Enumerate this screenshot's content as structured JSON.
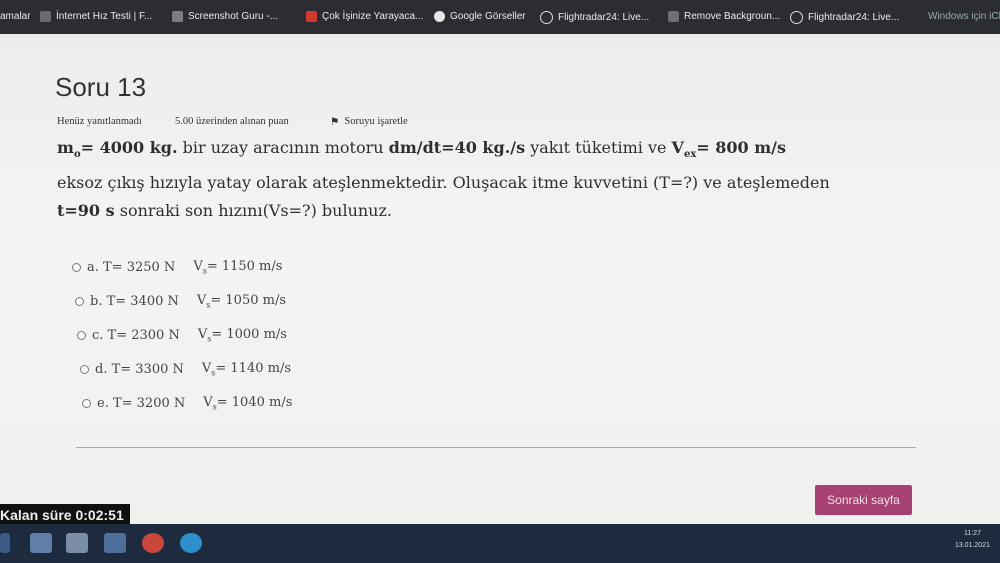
{
  "bookmarks": [
    {
      "label": "amalar",
      "color": "#2b2d33"
    },
    {
      "label": "İnternet Hız Testi | F...",
      "color": "#666a72"
    },
    {
      "label": "Screenshot Guru -...",
      "color": "#7a7d85"
    },
    {
      "label": "Çok İşinize Yarayaca...",
      "color": "#d03a2e"
    },
    {
      "label": "Google Görseller",
      "color": "#e8e8e8"
    },
    {
      "label": "Flightradar24: Live...",
      "color": "#dddddd"
    },
    {
      "label": "Remove Backgroun...",
      "color": "#6d7078"
    },
    {
      "label": "Flightradar24: Live...",
      "color": "#dddddd"
    },
    {
      "label": "Windows için iCli",
      "color": "#2b2d33"
    }
  ],
  "quiz": {
    "title": "Soru 13",
    "status": "Henüz yanıtlanmadı",
    "points": "5.00 üzerinden alınan puan",
    "flag_label": "Soruyu işaretle",
    "q": {
      "m0": "m",
      "m0_sub": "o",
      "m0_val": "= 4000 kg.",
      "p1": " bir uzay aracının motoru ",
      "dmdt": "dm/dt=40 kg./s",
      "p2": "  yakıt tüketimi ve ",
      "vex": "V",
      "vex_sub": "ex",
      "vex_val": "= 800 m/s",
      "line2": "eksoz çıkış hızıyla yatay olarak ateşlenmektedir.  Oluşacak itme kuvvetini (T=?) ve ateşlemeden",
      "t": "t=90 s",
      "p3": "  sonraki son hızını(Vs=?) bulunuz."
    },
    "options": [
      {
        "t": "a. T= 3250 N",
        "v": "V",
        "s": "s",
        "val": "= 1150 m/s"
      },
      {
        "t": "b. T= 3400 N",
        "v": "V",
        "s": "s",
        "val": "= 1050 m/s"
      },
      {
        "t": "c. T= 2300 N",
        "v": "V",
        "s": "s",
        "val": "= 1000 m/s"
      },
      {
        "t": "d. T= 3300 N",
        "v": "V",
        "s": "s",
        "val": "= 1140 m/s"
      },
      {
        "t": "e. T= 3200 N",
        "v": "V",
        "s": "s",
        "val": "= 1040 m/s"
      }
    ],
    "next_button": "Sonraki sayfa",
    "timer_label": "Kalan süre",
    "timer_value": "0:02:51"
  },
  "tray": {
    "time": "11:27",
    "date": "13.01.2021"
  },
  "colors": {
    "accent": "#a64273",
    "taskbar": "#1e2b3f"
  }
}
